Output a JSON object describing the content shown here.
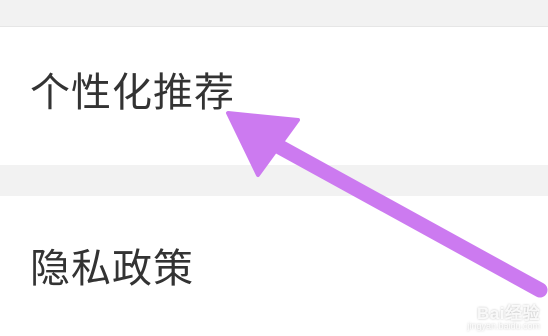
{
  "settings": {
    "items": [
      {
        "label": "个性化推荐"
      },
      {
        "label": "隐私政策"
      }
    ]
  },
  "annotation": {
    "arrow_color": "#cc7af0",
    "arrow_target": "个性化推荐"
  },
  "watermark": {
    "logo": "Bai经验",
    "url": "jingyan.baidu.com"
  },
  "colors": {
    "background": "#f2f2f2",
    "row_background": "#ffffff",
    "label_text": "#333333"
  }
}
